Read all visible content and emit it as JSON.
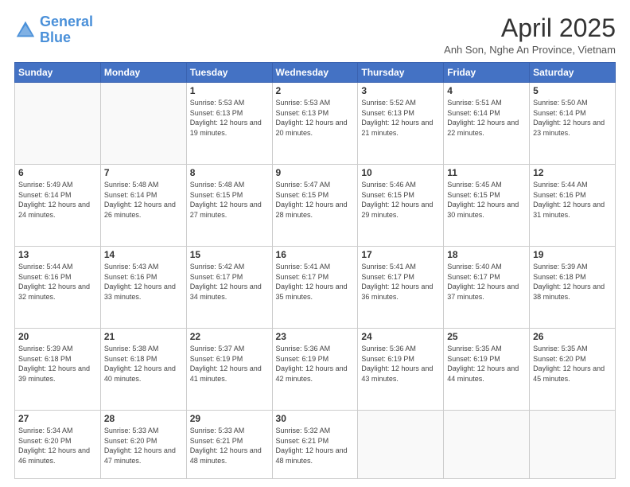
{
  "logo": {
    "line1": "General",
    "line2": "Blue"
  },
  "title": "April 2025",
  "subtitle": "Anh Son, Nghe An Province, Vietnam",
  "weekdays": [
    "Sunday",
    "Monday",
    "Tuesday",
    "Wednesday",
    "Thursday",
    "Friday",
    "Saturday"
  ],
  "weeks": [
    [
      {
        "day": "",
        "info": ""
      },
      {
        "day": "",
        "info": ""
      },
      {
        "day": "1",
        "info": "Sunrise: 5:53 AM\nSunset: 6:13 PM\nDaylight: 12 hours and 19 minutes."
      },
      {
        "day": "2",
        "info": "Sunrise: 5:53 AM\nSunset: 6:13 PM\nDaylight: 12 hours and 20 minutes."
      },
      {
        "day": "3",
        "info": "Sunrise: 5:52 AM\nSunset: 6:13 PM\nDaylight: 12 hours and 21 minutes."
      },
      {
        "day": "4",
        "info": "Sunrise: 5:51 AM\nSunset: 6:14 PM\nDaylight: 12 hours and 22 minutes."
      },
      {
        "day": "5",
        "info": "Sunrise: 5:50 AM\nSunset: 6:14 PM\nDaylight: 12 hours and 23 minutes."
      }
    ],
    [
      {
        "day": "6",
        "info": "Sunrise: 5:49 AM\nSunset: 6:14 PM\nDaylight: 12 hours and 24 minutes."
      },
      {
        "day": "7",
        "info": "Sunrise: 5:48 AM\nSunset: 6:14 PM\nDaylight: 12 hours and 26 minutes."
      },
      {
        "day": "8",
        "info": "Sunrise: 5:48 AM\nSunset: 6:15 PM\nDaylight: 12 hours and 27 minutes."
      },
      {
        "day": "9",
        "info": "Sunrise: 5:47 AM\nSunset: 6:15 PM\nDaylight: 12 hours and 28 minutes."
      },
      {
        "day": "10",
        "info": "Sunrise: 5:46 AM\nSunset: 6:15 PM\nDaylight: 12 hours and 29 minutes."
      },
      {
        "day": "11",
        "info": "Sunrise: 5:45 AM\nSunset: 6:15 PM\nDaylight: 12 hours and 30 minutes."
      },
      {
        "day": "12",
        "info": "Sunrise: 5:44 AM\nSunset: 6:16 PM\nDaylight: 12 hours and 31 minutes."
      }
    ],
    [
      {
        "day": "13",
        "info": "Sunrise: 5:44 AM\nSunset: 6:16 PM\nDaylight: 12 hours and 32 minutes."
      },
      {
        "day": "14",
        "info": "Sunrise: 5:43 AM\nSunset: 6:16 PM\nDaylight: 12 hours and 33 minutes."
      },
      {
        "day": "15",
        "info": "Sunrise: 5:42 AM\nSunset: 6:17 PM\nDaylight: 12 hours and 34 minutes."
      },
      {
        "day": "16",
        "info": "Sunrise: 5:41 AM\nSunset: 6:17 PM\nDaylight: 12 hours and 35 minutes."
      },
      {
        "day": "17",
        "info": "Sunrise: 5:41 AM\nSunset: 6:17 PM\nDaylight: 12 hours and 36 minutes."
      },
      {
        "day": "18",
        "info": "Sunrise: 5:40 AM\nSunset: 6:17 PM\nDaylight: 12 hours and 37 minutes."
      },
      {
        "day": "19",
        "info": "Sunrise: 5:39 AM\nSunset: 6:18 PM\nDaylight: 12 hours and 38 minutes."
      }
    ],
    [
      {
        "day": "20",
        "info": "Sunrise: 5:39 AM\nSunset: 6:18 PM\nDaylight: 12 hours and 39 minutes."
      },
      {
        "day": "21",
        "info": "Sunrise: 5:38 AM\nSunset: 6:18 PM\nDaylight: 12 hours and 40 minutes."
      },
      {
        "day": "22",
        "info": "Sunrise: 5:37 AM\nSunset: 6:19 PM\nDaylight: 12 hours and 41 minutes."
      },
      {
        "day": "23",
        "info": "Sunrise: 5:36 AM\nSunset: 6:19 PM\nDaylight: 12 hours and 42 minutes."
      },
      {
        "day": "24",
        "info": "Sunrise: 5:36 AM\nSunset: 6:19 PM\nDaylight: 12 hours and 43 minutes."
      },
      {
        "day": "25",
        "info": "Sunrise: 5:35 AM\nSunset: 6:19 PM\nDaylight: 12 hours and 44 minutes."
      },
      {
        "day": "26",
        "info": "Sunrise: 5:35 AM\nSunset: 6:20 PM\nDaylight: 12 hours and 45 minutes."
      }
    ],
    [
      {
        "day": "27",
        "info": "Sunrise: 5:34 AM\nSunset: 6:20 PM\nDaylight: 12 hours and 46 minutes."
      },
      {
        "day": "28",
        "info": "Sunrise: 5:33 AM\nSunset: 6:20 PM\nDaylight: 12 hours and 47 minutes."
      },
      {
        "day": "29",
        "info": "Sunrise: 5:33 AM\nSunset: 6:21 PM\nDaylight: 12 hours and 48 minutes."
      },
      {
        "day": "30",
        "info": "Sunrise: 5:32 AM\nSunset: 6:21 PM\nDaylight: 12 hours and 48 minutes."
      },
      {
        "day": "",
        "info": ""
      },
      {
        "day": "",
        "info": ""
      },
      {
        "day": "",
        "info": ""
      }
    ]
  ]
}
